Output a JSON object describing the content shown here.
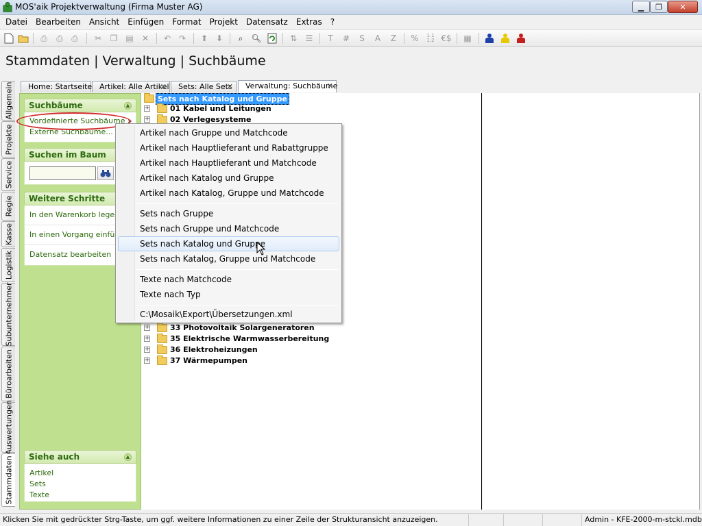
{
  "window": {
    "title": "MOS'aik Projektverwaltung (Firma Muster AG)",
    "min_glyph": "▁",
    "max_glyph": "❐",
    "close_glyph": "✕"
  },
  "menubar": [
    "Datei",
    "Bearbeiten",
    "Ansicht",
    "Einfügen",
    "Format",
    "Projekt",
    "Datensatz",
    "Extras",
    "?"
  ],
  "toolbar": {
    "text_buttons": [
      "T",
      "#",
      "S",
      "A",
      "Z",
      "%",
      "€$"
    ],
    "colors": {
      "person_blue": "#1f3fa8",
      "person_yellow": "#e8c800",
      "person_red": "#c41e1e"
    }
  },
  "page_title": "Stammdaten | Verwaltung | Suchbäume",
  "side_tabs": [
    "Allgemein",
    "Projekte",
    "Service",
    "Regie",
    "Kasse",
    "Logistik",
    "Subunternehmer",
    "Büroarbeiten",
    "Auswertungen",
    "Stammdaten"
  ],
  "doc_tabs": [
    {
      "label": "Home: Startseite",
      "closable": false
    },
    {
      "label": "Artikel: Alle Artikel",
      "closable": true
    },
    {
      "label": "Sets: Alle Sets",
      "closable": true
    },
    {
      "label": "Verwaltung: Suchbäume",
      "closable": true,
      "active": true
    }
  ],
  "left_panel": {
    "suchbaeume": {
      "title": "Suchbäume",
      "items": [
        "Vordefinierte Suchbäume",
        "Externe Suchbäume..."
      ],
      "submenu_arrow": "»"
    },
    "suchen": {
      "title": "Suchen im Baum",
      "input_value": "",
      "button_icon": "binoculars-icon"
    },
    "weitere": {
      "title": "Weitere Schritte",
      "items": [
        "In den Warenkorb legen",
        "In einen Vorgang einfügen",
        "Datensatz bearbeiten"
      ]
    },
    "siehe": {
      "title": "Siehe auch",
      "items": [
        "Artikel",
        "Sets",
        "Texte"
      ]
    },
    "collapse_glyph": "▲"
  },
  "tree": {
    "root": "Sets nach Katalog und Gruppe",
    "nodes_top": [
      "01 Kabel und Leitungen",
      "02 Verlegesysteme"
    ],
    "nodes_bottom": [
      "33 Photovoltaik Solargeneratoren",
      "35 Elektrische Warmwasserbereitung",
      "36 Elektroheizungen",
      "37 Wärmepumpen"
    ],
    "expand_glyph": "+"
  },
  "context_menu": {
    "groups": [
      [
        "Artikel nach Gruppe und Matchcode",
        "Artikel nach Hauptlieferant und Rabattgruppe",
        "Artikel nach Hauptlieferant und Matchcode",
        "Artikel nach Katalog und Gruppe",
        "Artikel nach Katalog, Gruppe und Matchcode"
      ],
      [
        "Sets nach Gruppe",
        "Sets nach Gruppe und Matchcode",
        "Sets nach Katalog und Gruppe",
        "Sets nach Katalog, Gruppe und Matchcode"
      ],
      [
        "Texte nach Matchcode",
        "Texte nach Typ"
      ],
      [
        "C:\\Mosaik\\Export\\Übersetzungen.xml"
      ]
    ],
    "highlighted": "Sets nach Katalog und Gruppe"
  },
  "statusbar": {
    "hint": "Klicken Sie mit gedrückter Strg-Taste, um ggf. weitere Informationen zu einer Zeile der Strukturansicht anzuzeigen.",
    "user_db": "Admin - KFE-2000-m-stckl.mdb"
  }
}
